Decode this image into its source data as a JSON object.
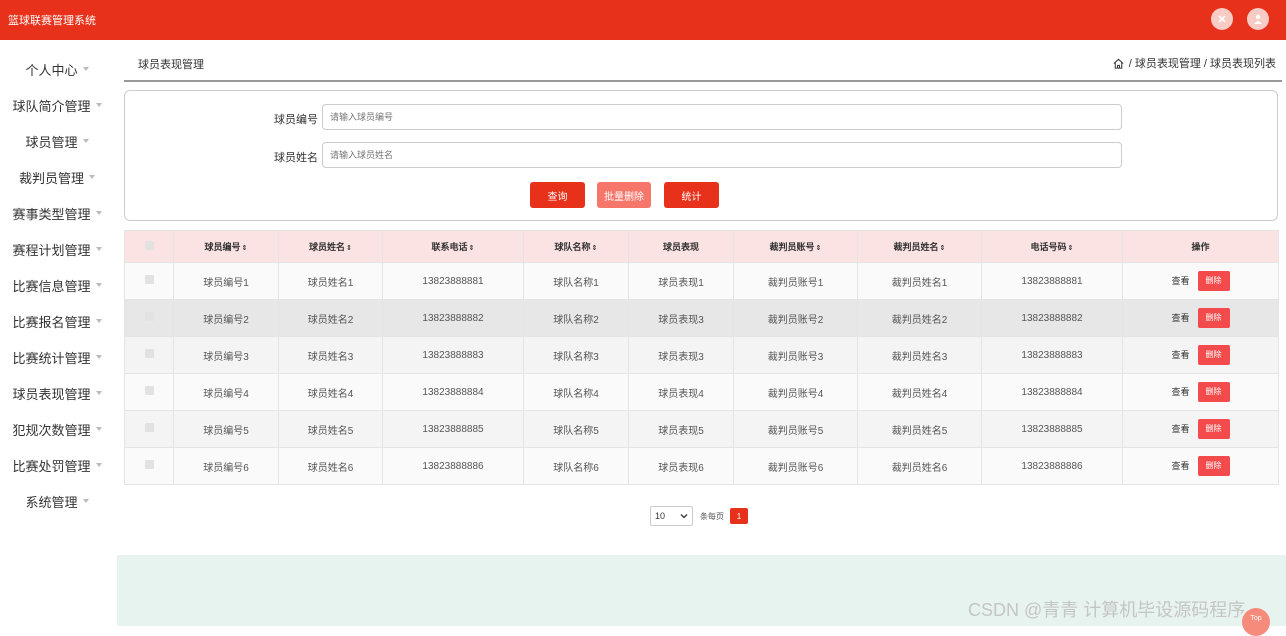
{
  "app": {
    "title": "篮球联赛管理系统"
  },
  "sidebar": {
    "items": [
      {
        "label": "个人中心"
      },
      {
        "label": "球队简介管理"
      },
      {
        "label": "球员管理"
      },
      {
        "label": "裁判员管理"
      },
      {
        "label": "赛事类型管理"
      },
      {
        "label": "赛程计划管理"
      },
      {
        "label": "比赛信息管理"
      },
      {
        "label": "比赛报名管理"
      },
      {
        "label": "比赛统计管理"
      },
      {
        "label": "球员表现管理"
      },
      {
        "label": "犯规次数管理"
      },
      {
        "label": "比赛处罚管理"
      },
      {
        "label": "系统管理"
      }
    ]
  },
  "page": {
    "title": "球员表现管理",
    "breadcrumb": "/ 球员表现管理 / 球员表现列表"
  },
  "search": {
    "fields": [
      {
        "label": "球员编号",
        "placeholder": "请输入球员编号"
      },
      {
        "label": "球员姓名",
        "placeholder": "请输入球员姓名"
      }
    ],
    "buttons": {
      "query": "查询",
      "batch_delete": "批量删除",
      "stats": "统计"
    }
  },
  "table": {
    "headers": [
      "球员编号",
      "球员姓名",
      "联系电话",
      "球队名称",
      "球员表现",
      "裁判员账号",
      "裁判员姓名",
      "电话号码",
      "操作"
    ],
    "rows": [
      [
        "球员编号1",
        "球员姓名1",
        "13823888881",
        "球队名称1",
        "球员表现1",
        "裁判员账号1",
        "裁判员姓名1",
        "13823888881"
      ],
      [
        "球员编号2",
        "球员姓名2",
        "13823888882",
        "球队名称2",
        "球员表现3",
        "裁判员账号2",
        "裁判员姓名2",
        "13823888882"
      ],
      [
        "球员编号3",
        "球员姓名3",
        "13823888883",
        "球队名称3",
        "球员表现3",
        "裁判员账号3",
        "裁判员姓名3",
        "13823888883"
      ],
      [
        "球员编号4",
        "球员姓名4",
        "13823888884",
        "球队名称4",
        "球员表现4",
        "裁判员账号4",
        "裁判员姓名4",
        "13823888884"
      ],
      [
        "球员编号5",
        "球员姓名5",
        "13823888885",
        "球队名称5",
        "球员表现5",
        "裁判员账号5",
        "裁判员姓名5",
        "13823888885"
      ],
      [
        "球员编号6",
        "球员姓名6",
        "13823888886",
        "球队名称6",
        "球员表现6",
        "裁判员账号6",
        "裁判员姓名6",
        "13823888886"
      ]
    ],
    "actions": {
      "view": "查看",
      "delete": "删除"
    },
    "sort_glyph": "⇕"
  },
  "pager": {
    "page_size": "10",
    "per_page_label": "条每页",
    "current_page": "1"
  },
  "watermark": "CSDN @青青  计算机毕设源码程序",
  "back_to_top": "Top",
  "icons": {
    "topbar": [
      "close-circle-icon",
      "user-icon"
    ],
    "breadcrumb": "home-icon",
    "select": "chevron-down-icon"
  },
  "colors": {
    "brand": "#e8311a",
    "header_row": "#fbe3e3",
    "delete_button": "#f34b4b",
    "batch_delete_button": "#f7766a",
    "footer_band": "#e7f3ef"
  }
}
